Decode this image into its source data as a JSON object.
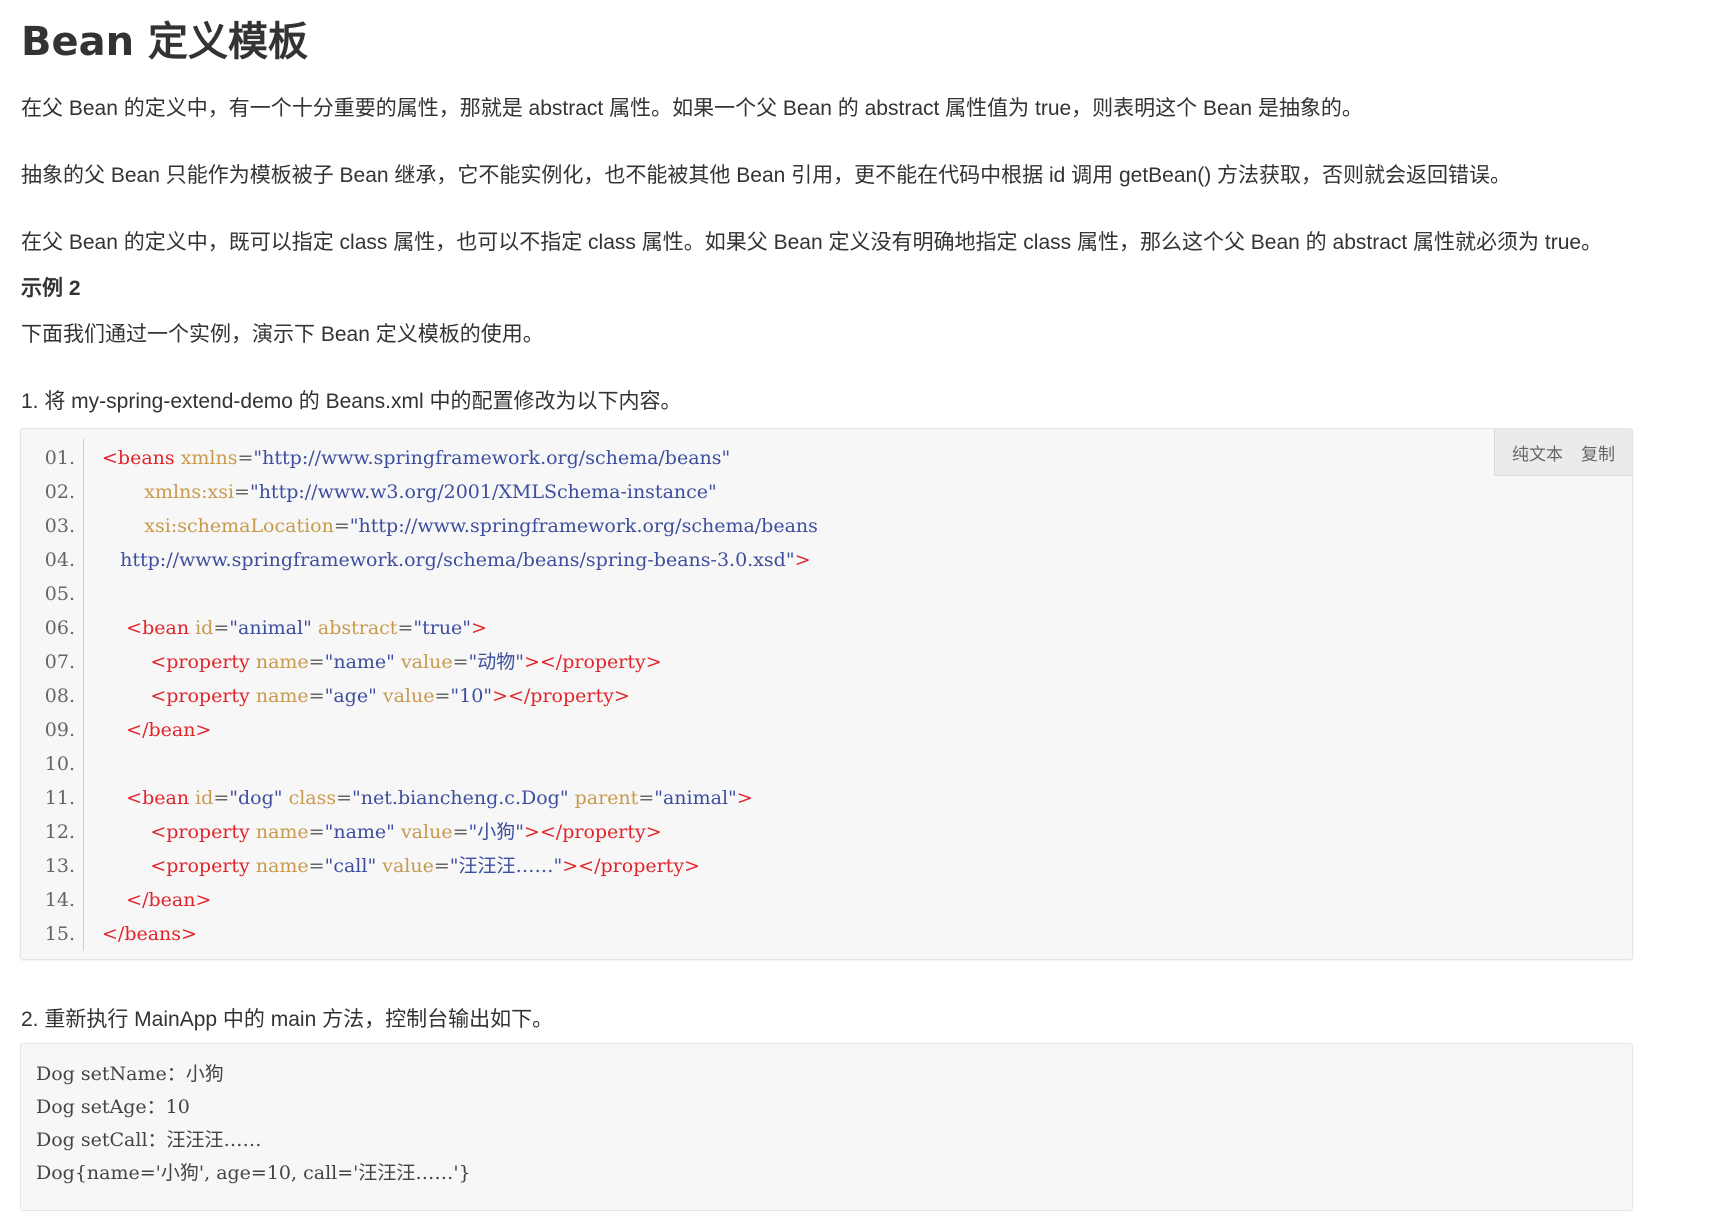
{
  "title": "Bean 定义模板",
  "paragraphs": {
    "p1": "在父 Bean 的定义中，有一个十分重要的属性，那就是 abstract 属性。如果一个父 Bean 的 abstract 属性值为 true，则表明这个 Bean 是抽象的。",
    "p2": "抽象的父 Bean 只能作为模板被子 Bean 继承，它不能实例化，也不能被其他 Bean 引用，更不能在代码中根据 id 调用 getBean() 方法获取，否则就会返回错误。",
    "p3": "在父 Bean 的定义中，既可以指定 class 属性，也可以不指定 class 属性。如果父 Bean 定义没有明确地指定 class 属性，那么这个父 Bean 的 abstract 属性就必须为 true。",
    "example_heading": "示例 2",
    "p4": "下面我们通过一个实例，演示下 Bean 定义模板的使用。",
    "step1": "1. 将 my-spring-extend-demo 的 Beans.xml 中的配置修改为以下内容。",
    "step2": "2. 重新执行 MainApp 中的 main 方法，控制台输出如下。"
  },
  "code_toolbar": {
    "plain_text": "纯文本",
    "copy": "复制"
  },
  "code": {
    "line_numbers": [
      "01.",
      "02.",
      "03.",
      "04.",
      "05.",
      "06.",
      "07.",
      "08.",
      "09.",
      "10.",
      "11.",
      "12.",
      "13.",
      "14.",
      "15."
    ],
    "lines": [
      [
        {
          "t": "tag",
          "v": "<beans "
        },
        {
          "t": "attr",
          "v": "xmlns"
        },
        {
          "t": "punct",
          "v": "="
        },
        {
          "t": "val",
          "v": "\"http://www.springframework.org/schema/beans\""
        }
      ],
      [
        {
          "t": "punct",
          "v": "       "
        },
        {
          "t": "attr",
          "v": "xmlns:xsi"
        },
        {
          "t": "punct",
          "v": "="
        },
        {
          "t": "val",
          "v": "\"http://www.w3.org/2001/XMLSchema-instance\""
        }
      ],
      [
        {
          "t": "punct",
          "v": "       "
        },
        {
          "t": "attr",
          "v": "xsi:schemaLocation"
        },
        {
          "t": "punct",
          "v": "="
        },
        {
          "t": "val",
          "v": "\"http://www.springframework.org/schema/beans"
        }
      ],
      [
        {
          "t": "val",
          "v": "   http://www.springframework.org/schema/beans/spring-beans-3.0.xsd\""
        },
        {
          "t": "tag",
          "v": ">"
        }
      ],
      [],
      [
        {
          "t": "punct",
          "v": "    "
        },
        {
          "t": "tag",
          "v": "<bean "
        },
        {
          "t": "attr",
          "v": "id"
        },
        {
          "t": "punct",
          "v": "="
        },
        {
          "t": "val",
          "v": "\"animal\" "
        },
        {
          "t": "attr",
          "v": "abstract"
        },
        {
          "t": "punct",
          "v": "="
        },
        {
          "t": "val",
          "v": "\"true\""
        },
        {
          "t": "tag",
          "v": ">"
        }
      ],
      [
        {
          "t": "punct",
          "v": "        "
        },
        {
          "t": "tag",
          "v": "<property "
        },
        {
          "t": "attr",
          "v": "name"
        },
        {
          "t": "punct",
          "v": "="
        },
        {
          "t": "val",
          "v": "\"name\" "
        },
        {
          "t": "attr",
          "v": "value"
        },
        {
          "t": "punct",
          "v": "="
        },
        {
          "t": "val",
          "v": "\"动物\""
        },
        {
          "t": "tag",
          "v": "></property>"
        }
      ],
      [
        {
          "t": "punct",
          "v": "        "
        },
        {
          "t": "tag",
          "v": "<property "
        },
        {
          "t": "attr",
          "v": "name"
        },
        {
          "t": "punct",
          "v": "="
        },
        {
          "t": "val",
          "v": "\"age\" "
        },
        {
          "t": "attr",
          "v": "value"
        },
        {
          "t": "punct",
          "v": "="
        },
        {
          "t": "val",
          "v": "\"10\""
        },
        {
          "t": "tag",
          "v": "></property>"
        }
      ],
      [
        {
          "t": "punct",
          "v": "    "
        },
        {
          "t": "tag",
          "v": "</bean>"
        }
      ],
      [],
      [
        {
          "t": "punct",
          "v": "    "
        },
        {
          "t": "tag",
          "v": "<bean "
        },
        {
          "t": "attr",
          "v": "id"
        },
        {
          "t": "punct",
          "v": "="
        },
        {
          "t": "val",
          "v": "\"dog\" "
        },
        {
          "t": "attr",
          "v": "class"
        },
        {
          "t": "punct",
          "v": "="
        },
        {
          "t": "val",
          "v": "\"net.biancheng.c.Dog\" "
        },
        {
          "t": "attr",
          "v": "parent"
        },
        {
          "t": "punct",
          "v": "="
        },
        {
          "t": "val",
          "v": "\"animal\""
        },
        {
          "t": "tag",
          "v": ">"
        }
      ],
      [
        {
          "t": "punct",
          "v": "        "
        },
        {
          "t": "tag",
          "v": "<property "
        },
        {
          "t": "attr",
          "v": "name"
        },
        {
          "t": "punct",
          "v": "="
        },
        {
          "t": "val",
          "v": "\"name\" "
        },
        {
          "t": "attr",
          "v": "value"
        },
        {
          "t": "punct",
          "v": "="
        },
        {
          "t": "val",
          "v": "\"小狗\""
        },
        {
          "t": "tag",
          "v": "></property>"
        }
      ],
      [
        {
          "t": "punct",
          "v": "        "
        },
        {
          "t": "tag",
          "v": "<property "
        },
        {
          "t": "attr",
          "v": "name"
        },
        {
          "t": "punct",
          "v": "="
        },
        {
          "t": "val",
          "v": "\"call\" "
        },
        {
          "t": "attr",
          "v": "value"
        },
        {
          "t": "punct",
          "v": "="
        },
        {
          "t": "val",
          "v": "\"汪汪汪……\""
        },
        {
          "t": "tag",
          "v": "></property>"
        }
      ],
      [
        {
          "t": "punct",
          "v": "    "
        },
        {
          "t": "tag",
          "v": "</bean>"
        }
      ],
      [
        {
          "t": "tag",
          "v": "</beans>"
        }
      ]
    ]
  },
  "output": {
    "lines": [
      "Dog setName：小狗",
      "Dog setAge：10",
      "Dog setCall：汪汪汪……",
      "Dog{name='小狗', age=10, call='汪汪汪……'}"
    ]
  },
  "colors": {
    "tag": "#e2232a",
    "attr": "#c89a4e",
    "value": "#3d4e9e",
    "code_bg": "#f7f7f7"
  }
}
